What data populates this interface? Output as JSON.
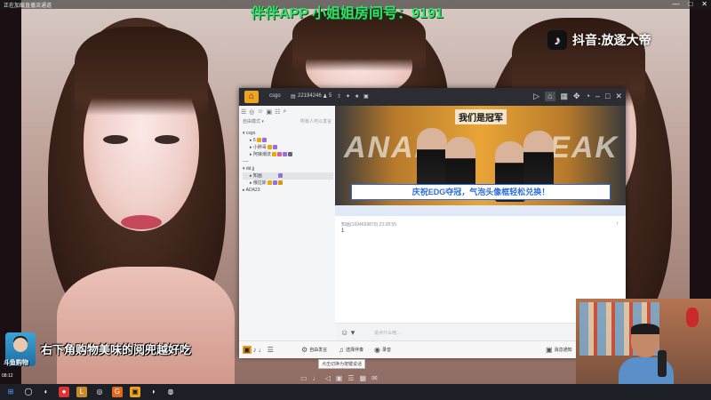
{
  "stream": {
    "top_left_text": "正在加载直播流通道",
    "room_banner": "伴伴APP 小姐姐房间号：9191",
    "watermark": "抖音:放逐大帝",
    "window_controls": [
      "—",
      "□",
      "✕"
    ],
    "promo_text": "右下角购物美味的阅兜越好吃",
    "avatar_label": "斗鱼购物",
    "time_small": "08:12"
  },
  "app": {
    "title": {
      "channel": "csgo",
      "room_id": "22194246",
      "user_count": "5"
    },
    "sidebar": {
      "mode": "自由模式",
      "right_hint": "所有人可以发言",
      "tree": [
        {
          "label": "csgo",
          "level": 0,
          "arrow": "▾"
        },
        {
          "label": "5",
          "level": 1,
          "arrow": "▸"
        },
        {
          "label": "小胖哥",
          "level": 1,
          "arrow": "▸"
        },
        {
          "label": "阿娘潮流",
          "level": 1,
          "arrow": "▸"
        },
        {
          "label": "----",
          "level": 0,
          "arrow": ""
        },
        {
          "label": "dd.jj",
          "level": 0,
          "arrow": "▾"
        },
        {
          "label": "知画",
          "level": 1,
          "arrow": "▸"
        },
        {
          "label": "俄拉斯",
          "level": 1,
          "arrow": "▸"
        },
        {
          "label": "ADA23",
          "level": 0,
          "arrow": "▸"
        }
      ]
    },
    "banner": {
      "left_word": "ANAP",
      "right_word": "PEAK",
      "champion_text": "我们是冠军",
      "caption": "庆祝EDG夺冠，气泡头像框轻松兑换！"
    },
    "chat": {
      "message_header": "知画(1694669870)  23:28:55",
      "message_body": "1",
      "pin_icon": "↑"
    },
    "input": {
      "placeholder": "说点什么吧..."
    },
    "bottombar": {
      "free_speak": "自由发言",
      "choose_music": "选择伴奏",
      "record": "录音",
      "message_settings": "消息通知",
      "tooltip": "点击切换为按键说话"
    }
  }
}
